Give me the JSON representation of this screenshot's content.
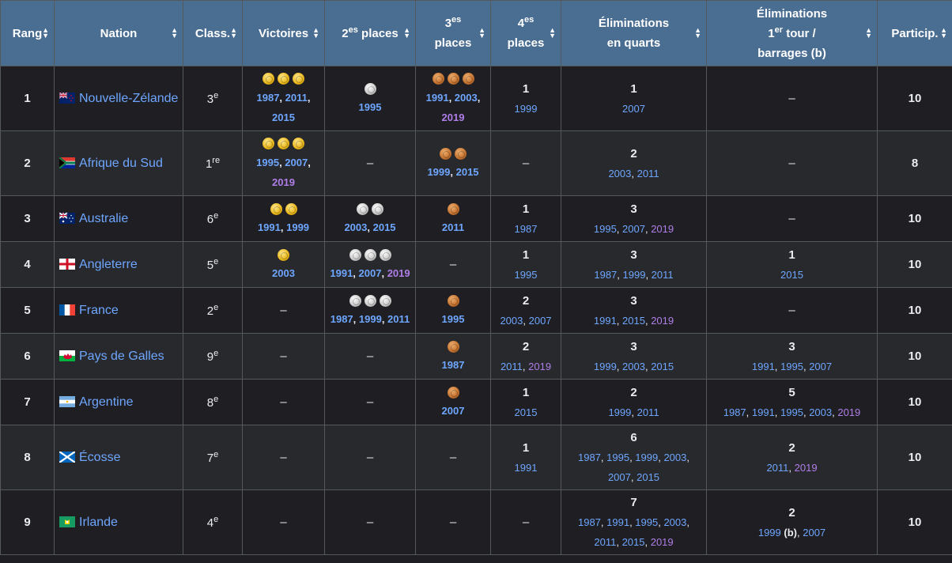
{
  "headers": {
    "rang": "Rang",
    "nation": "Nation",
    "classement": "Class.",
    "victoires": "Victoires",
    "second_pre": "2",
    "second_sup": "es",
    "second_post": " places",
    "third_pre": "3",
    "third_sup": "es",
    "third_post": "places",
    "fourth_pre": "4",
    "fourth_sup": "es",
    "fourth_post": "places",
    "quarts_line1": "Éliminations",
    "quarts_line2": "en quarts",
    "first_line1": "Éliminations",
    "first_pre": "1",
    "first_sup": "er",
    "first_post": " tour /",
    "first_line3": "barrages (b)",
    "particip": "Particip."
  },
  "dash": "–",
  "rows": [
    {
      "rank": "1",
      "nation": "Nouvelle-Zélande",
      "flag": "nz",
      "class_num": "3",
      "class_sup": "e",
      "wins": {
        "medals": 3,
        "years": [
          [
            "1987",
            false
          ],
          [
            "2011",
            false
          ],
          [
            "2015",
            false
          ]
        ],
        "lines": [
          [
            0,
            1
          ],
          [
            2
          ]
        ]
      },
      "second": {
        "medals": 1,
        "years": [
          [
            "1995",
            false
          ]
        ],
        "lines": [
          [
            0
          ]
        ]
      },
      "third": {
        "medals": 3,
        "years": [
          [
            "1991",
            false
          ],
          [
            "2003",
            false
          ],
          [
            "2019",
            true
          ]
        ],
        "lines": [
          [
            0,
            1
          ],
          [
            2
          ]
        ]
      },
      "fourth": {
        "count": "1",
        "years": [
          [
            "1999",
            false
          ]
        ],
        "lines": [
          [
            0
          ]
        ]
      },
      "quarters": {
        "count": "1",
        "years": [
          [
            "2007",
            false
          ]
        ],
        "lines": [
          [
            0
          ]
        ]
      },
      "first_round": null,
      "participations": "10"
    },
    {
      "rank": "2",
      "nation": "Afrique du Sud",
      "flag": "za",
      "class_num": "1",
      "class_sup": "re",
      "wins": {
        "medals": 3,
        "years": [
          [
            "1995",
            false
          ],
          [
            "2007",
            false
          ],
          [
            "2019",
            true
          ]
        ],
        "lines": [
          [
            0,
            1
          ],
          [
            2
          ]
        ]
      },
      "second": null,
      "third": {
        "medals": 2,
        "years": [
          [
            "1999",
            false
          ],
          [
            "2015",
            false
          ]
        ],
        "lines": [
          [
            0,
            1
          ]
        ]
      },
      "fourth": null,
      "quarters": {
        "count": "2",
        "years": [
          [
            "2003",
            false
          ],
          [
            "2011",
            false
          ]
        ],
        "lines": [
          [
            0,
            1
          ]
        ]
      },
      "first_round": null,
      "participations": "8"
    },
    {
      "rank": "3",
      "nation": "Australie",
      "flag": "au",
      "class_num": "6",
      "class_sup": "e",
      "wins": {
        "medals": 2,
        "years": [
          [
            "1991",
            false
          ],
          [
            "1999",
            false
          ]
        ],
        "lines": [
          [
            0,
            1
          ]
        ]
      },
      "second": {
        "medals": 2,
        "years": [
          [
            "2003",
            false
          ],
          [
            "2015",
            false
          ]
        ],
        "lines": [
          [
            0,
            1
          ]
        ]
      },
      "third": {
        "medals": 1,
        "years": [
          [
            "2011",
            false
          ]
        ],
        "lines": [
          [
            0
          ]
        ]
      },
      "fourth": {
        "count": "1",
        "years": [
          [
            "1987",
            false
          ]
        ],
        "lines": [
          [
            0
          ]
        ]
      },
      "quarters": {
        "count": "3",
        "years": [
          [
            "1995",
            false
          ],
          [
            "2007",
            false
          ],
          [
            "2019",
            true
          ]
        ],
        "lines": [
          [
            0,
            1,
            2
          ]
        ]
      },
      "first_round": null,
      "participations": "10"
    },
    {
      "rank": "4",
      "nation": "Angleterre",
      "flag": "en",
      "class_num": "5",
      "class_sup": "e",
      "wins": {
        "medals": 1,
        "years": [
          [
            "2003",
            false
          ]
        ],
        "lines": [
          [
            0
          ]
        ]
      },
      "second": {
        "medals": 3,
        "years": [
          [
            "1991",
            false
          ],
          [
            "2007",
            false
          ],
          [
            "2019",
            true
          ]
        ],
        "lines": [
          [
            0,
            1,
            2
          ]
        ]
      },
      "third": null,
      "fourth": {
        "count": "1",
        "years": [
          [
            "1995",
            false
          ]
        ],
        "lines": [
          [
            0
          ]
        ]
      },
      "quarters": {
        "count": "3",
        "years": [
          [
            "1987",
            false
          ],
          [
            "1999",
            false
          ],
          [
            "2011",
            false
          ]
        ],
        "lines": [
          [
            0,
            1,
            2
          ]
        ]
      },
      "first_round": {
        "count": "1",
        "years": [
          [
            "2015",
            false
          ]
        ],
        "lines": [
          [
            0
          ]
        ]
      },
      "participations": "10"
    },
    {
      "rank": "5",
      "nation": "France",
      "flag": "fr",
      "class_num": "2",
      "class_sup": "e",
      "wins": null,
      "second": {
        "medals": 3,
        "years": [
          [
            "1987",
            false
          ],
          [
            "1999",
            false
          ],
          [
            "2011",
            false
          ]
        ],
        "lines": [
          [
            0,
            1,
            2
          ]
        ]
      },
      "third": {
        "medals": 1,
        "years": [
          [
            "1995",
            false
          ]
        ],
        "lines": [
          [
            0
          ]
        ]
      },
      "fourth": {
        "count": "2",
        "years": [
          [
            "2003",
            false
          ],
          [
            "2007",
            false
          ]
        ],
        "lines": [
          [
            0,
            1
          ]
        ]
      },
      "quarters": {
        "count": "3",
        "years": [
          [
            "1991",
            false
          ],
          [
            "2015",
            false
          ],
          [
            "2019",
            true
          ]
        ],
        "lines": [
          [
            0,
            1,
            2
          ]
        ]
      },
      "first_round": null,
      "participations": "10"
    },
    {
      "rank": "6",
      "nation": "Pays de Galles",
      "flag": "wa",
      "class_num": "9",
      "class_sup": "e",
      "wins": null,
      "second": null,
      "third": {
        "medals": 1,
        "years": [
          [
            "1987",
            false
          ]
        ],
        "lines": [
          [
            0
          ]
        ]
      },
      "fourth": {
        "count": "2",
        "years": [
          [
            "2011",
            false
          ],
          [
            "2019",
            true
          ]
        ],
        "lines": [
          [
            0,
            1
          ]
        ]
      },
      "quarters": {
        "count": "3",
        "years": [
          [
            "1999",
            false
          ],
          [
            "2003",
            false
          ],
          [
            "2015",
            false
          ]
        ],
        "lines": [
          [
            0,
            1,
            2
          ]
        ]
      },
      "first_round": {
        "count": "3",
        "years": [
          [
            "1991",
            false
          ],
          [
            "1995",
            false
          ],
          [
            "2007",
            false
          ]
        ],
        "lines": [
          [
            0,
            1,
            2
          ]
        ]
      },
      "participations": "10"
    },
    {
      "rank": "7",
      "nation": "Argentine",
      "flag": "ar",
      "class_num": "8",
      "class_sup": "e",
      "wins": null,
      "second": null,
      "third": {
        "medals": 1,
        "years": [
          [
            "2007",
            false
          ]
        ],
        "lines": [
          [
            0
          ]
        ]
      },
      "fourth": {
        "count": "1",
        "years": [
          [
            "2015",
            false
          ]
        ],
        "lines": [
          [
            0
          ]
        ]
      },
      "quarters": {
        "count": "2",
        "years": [
          [
            "1999",
            false
          ],
          [
            "2011",
            false
          ]
        ],
        "lines": [
          [
            0,
            1
          ]
        ]
      },
      "first_round": {
        "count": "5",
        "years": [
          [
            "1987",
            false
          ],
          [
            "1991",
            false
          ],
          [
            "1995",
            false
          ],
          [
            "2003",
            false
          ],
          [
            "2019",
            true
          ]
        ],
        "lines": [
          [
            0,
            1,
            2,
            3,
            4
          ]
        ]
      },
      "participations": "10"
    },
    {
      "rank": "8",
      "nation": "Écosse",
      "flag": "sc",
      "class_num": "7",
      "class_sup": "e",
      "wins": null,
      "second": null,
      "third": null,
      "fourth": {
        "count": "1",
        "years": [
          [
            "1991",
            false
          ]
        ],
        "lines": [
          [
            0
          ]
        ]
      },
      "quarters": {
        "count": "6",
        "years": [
          [
            "1987",
            false
          ],
          [
            "1995",
            false
          ],
          [
            "1999",
            false
          ],
          [
            "2003",
            false
          ],
          [
            "2007",
            false
          ],
          [
            "2015",
            false
          ]
        ],
        "lines": [
          [
            0,
            1,
            2,
            3
          ],
          [
            4,
            5
          ]
        ]
      },
      "first_round": {
        "count": "2",
        "years": [
          [
            "2011",
            false
          ],
          [
            "2019",
            true
          ]
        ],
        "lines": [
          [
            0,
            1
          ]
        ]
      },
      "participations": "10"
    },
    {
      "rank": "9",
      "nation": "Irlande",
      "flag": "ie",
      "class_num": "4",
      "class_sup": "e",
      "wins": null,
      "second": null,
      "third": null,
      "fourth": null,
      "quarters": {
        "count": "7",
        "years": [
          [
            "1987",
            false
          ],
          [
            "1991",
            false
          ],
          [
            "1995",
            false
          ],
          [
            "2003",
            false
          ],
          [
            "2011",
            false
          ],
          [
            "2015",
            false
          ],
          [
            "2019",
            true
          ]
        ],
        "lines": [
          [
            0,
            1,
            2,
            3
          ],
          [
            4,
            5,
            6
          ]
        ]
      },
      "first_round": {
        "count": "2",
        "years": [
          [
            "1999",
            false
          ],
          [
            "2007",
            false
          ]
        ],
        "lines": [
          [
            0,
            1
          ]
        ],
        "note_after": 0,
        "note": "(b)"
      },
      "participations": "10"
    }
  ]
}
